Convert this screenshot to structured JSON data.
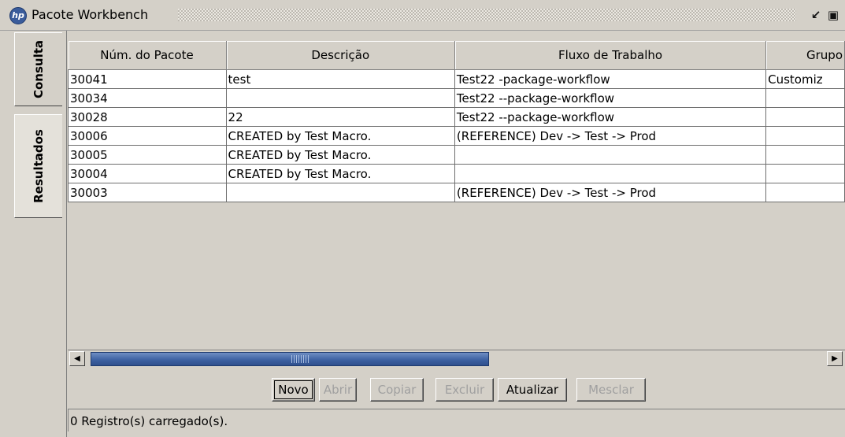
{
  "window": {
    "title": "Pacote Workbench",
    "logo_text": "hp",
    "restore_icon": "restore-icon",
    "maximize_icon": "maximize-icon"
  },
  "tabs": [
    {
      "label": "Consulta",
      "active": false
    },
    {
      "label": "Resultados",
      "active": true
    }
  ],
  "table": {
    "columns": [
      "Núm. do Pacote",
      "Descrição",
      "Fluxo de Trabalho",
      "Grupo"
    ],
    "rows": [
      [
        "30041",
        "test",
        " Test22 -package-workflow",
        "Customiz"
      ],
      [
        "30034",
        "",
        "Test22 --package-workflow",
        ""
      ],
      [
        "30028",
        "22",
        "Test22 --package-workflow",
        ""
      ],
      [
        "30006",
        "CREATED by Test Macro.",
        "(REFERENCE) Dev -> Test -> Prod",
        ""
      ],
      [
        "30005",
        "CREATED by Test Macro.",
        "",
        ""
      ],
      [
        "30004",
        "CREATED by Test Macro.",
        "",
        ""
      ],
      [
        "30003",
        "",
        "(REFERENCE) Dev -> Test -> Prod",
        ""
      ]
    ]
  },
  "scrollbar": {
    "position": 0.0,
    "visible_fraction": 0.56
  },
  "buttons": {
    "novo": "Novo",
    "abrir": "Abrir",
    "copiar": "Copiar",
    "excluir": "Excluir",
    "atualizar": "Atualizar",
    "mesclar": "Mesclar"
  },
  "status": "0 Registro(s) carregado(s).",
  "colors": {
    "accent": "#3b5fa0",
    "background": "#d4d0c8"
  }
}
